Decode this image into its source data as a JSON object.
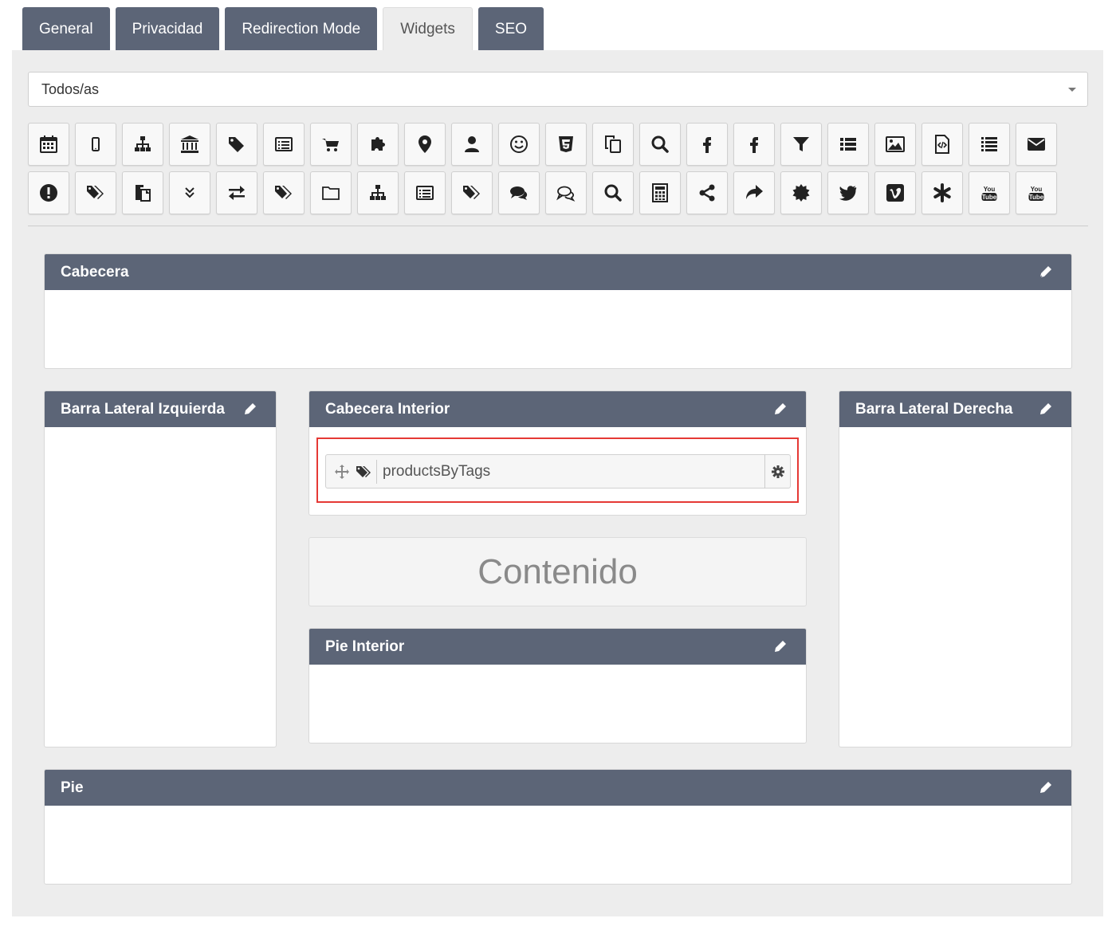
{
  "tabs": [
    {
      "label": "General",
      "active": false
    },
    {
      "label": "Privacidad",
      "active": false
    },
    {
      "label": "Redirection Mode",
      "active": false
    },
    {
      "label": "Widgets",
      "active": true
    },
    {
      "label": "SEO",
      "active": false
    }
  ],
  "filter": {
    "selected": "Todos/as"
  },
  "icons_row1": [
    "calendar-icon",
    "mobile-icon",
    "sitemap-icon",
    "bank-icon",
    "tag-icon",
    "list-alt-icon",
    "cart-icon",
    "puzzle-icon",
    "map-marker-icon",
    "user-icon",
    "smile-icon",
    "html5-icon",
    "copy-icon",
    "search-icon",
    "facebook-icon",
    "facebook-alt-icon",
    "filter-icon",
    "list-ul-icon",
    "image-icon",
    "code-file-icon",
    "list-icon",
    "envelope-icon"
  ],
  "icons_row2": [
    "exclamation-icon",
    "tags-icon",
    "paste-icon",
    "double-chevron-down-icon",
    "exchange-icon",
    "tags-alt-icon",
    "folder-icon",
    "sitemap-alt-icon",
    "list-alt-alt-icon",
    "tags-third-icon",
    "comments-icon",
    "comments-outline-icon",
    "search-alt-icon",
    "calculator-icon",
    "share-icon",
    "share-arrow-icon",
    "certificate-icon",
    "twitter-icon",
    "vimeo-icon",
    "asterisk-icon",
    "youtube-icon",
    "youtube-alt-icon"
  ],
  "blocks": {
    "header": {
      "title": "Cabecera"
    },
    "left_sidebar": {
      "title": "Barra Lateral Izquierda"
    },
    "inner_header": {
      "title": "Cabecera Interior"
    },
    "right_sidebar": {
      "title": "Barra Lateral Derecha"
    },
    "content": {
      "title": "Contenido"
    },
    "inner_footer": {
      "title": "Pie Interior"
    },
    "footer": {
      "title": "Pie"
    }
  },
  "widget": {
    "name": "productsByTags"
  },
  "colors": {
    "header_bg": "#5c6577",
    "highlight": "#e53935"
  }
}
